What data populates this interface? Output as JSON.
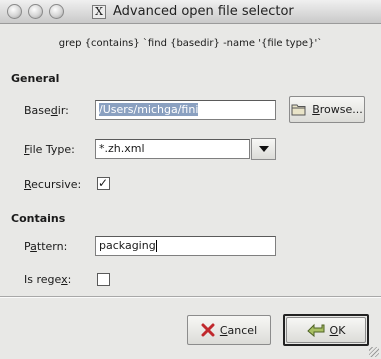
{
  "window": {
    "title": "Advanced open file selector",
    "title_icon": "X"
  },
  "command": "grep {contains} `find {basedir} -name '{file type}'`",
  "general": {
    "heading": "General",
    "basedir": {
      "label_pre": "Base",
      "label_u": "d",
      "label_post": "ir:",
      "value": "/Users/michga/fini",
      "browse_u": "B",
      "browse_post": "rowse..."
    },
    "filetype": {
      "label_pre": "",
      "label_u": "F",
      "label_post": "ile Type:",
      "value": "*.zh.xml"
    },
    "recursive": {
      "label_pre": "",
      "label_u": "R",
      "label_post": "ecursive:",
      "checked": true,
      "mark": "✓"
    }
  },
  "contains": {
    "heading": "Contains",
    "pattern": {
      "label_pre": "P",
      "label_u": "a",
      "label_post": "ttern:",
      "value": "packaging"
    },
    "regex": {
      "label_pre": "Is rege",
      "label_u": "x",
      "label_post": ":",
      "checked": false
    }
  },
  "buttons": {
    "cancel": {
      "u": "C",
      "post": "ancel"
    },
    "ok": {
      "u": "O",
      "post": "K"
    }
  },
  "colors": {
    "background": "#e8e8e6",
    "selection": "#8aa0c0",
    "cancel_x": "#c0282d",
    "ok_icon": "#6f8a3a"
  }
}
